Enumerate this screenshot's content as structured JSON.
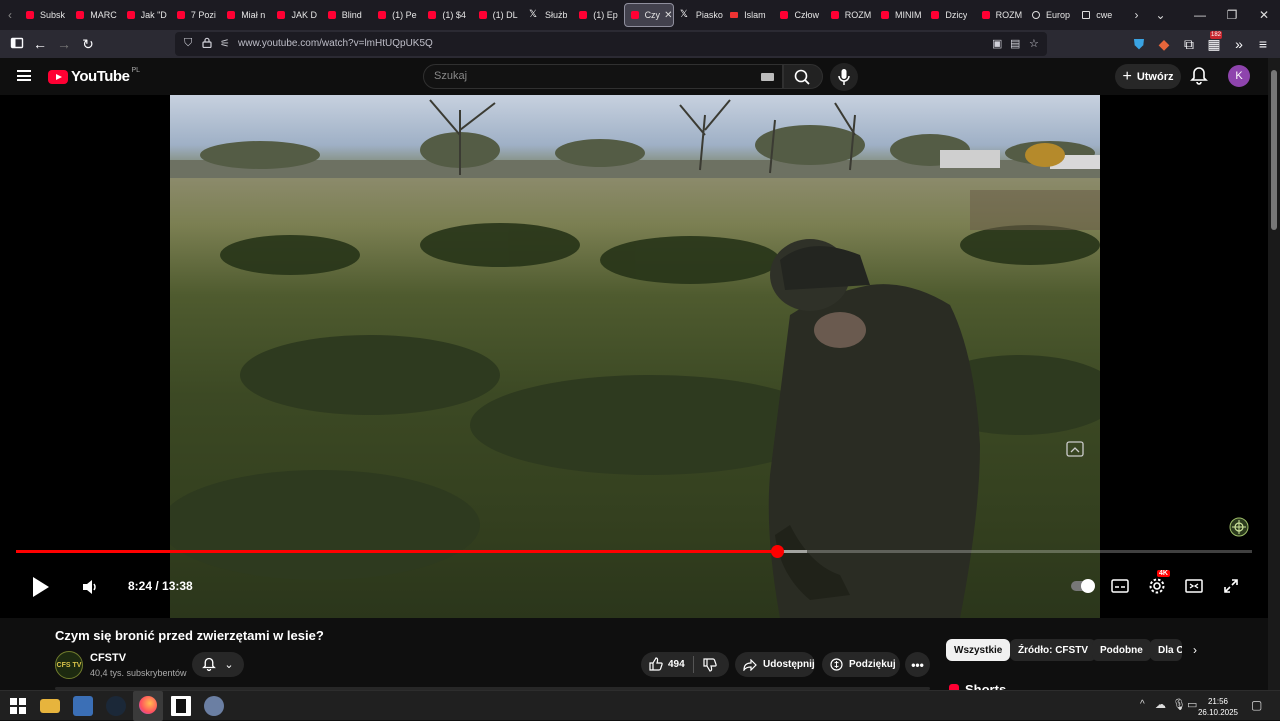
{
  "browser": {
    "tabs": [
      {
        "label": "Subsk",
        "icon": "youtube-icon"
      },
      {
        "label": "MARC",
        "icon": "youtube-icon"
      },
      {
        "label": "Jak \"D",
        "icon": "youtube-icon"
      },
      {
        "label": "7 Pozi",
        "icon": "youtube-icon"
      },
      {
        "label": "Miał n",
        "icon": "youtube-icon"
      },
      {
        "label": "JAK D",
        "icon": "youtube-icon"
      },
      {
        "label": "Blind",
        "icon": "youtube-icon"
      },
      {
        "label": "(1) Pe",
        "icon": "youtube-icon"
      },
      {
        "label": "(1) $4",
        "icon": "youtube-icon"
      },
      {
        "label": "(1) DL",
        "icon": "youtube-icon"
      },
      {
        "label": "Służb",
        "icon": "x-icon"
      },
      {
        "label": "(1) Ep",
        "icon": "youtube-icon"
      },
      {
        "label": "Czy",
        "icon": "youtube-icon",
        "active": true
      },
      {
        "label": "Piasko",
        "icon": "x-icon"
      },
      {
        "label": "Islam",
        "icon": "onet-icon"
      },
      {
        "label": "Człow",
        "icon": "youtube-icon"
      },
      {
        "label": "ROZM",
        "icon": "youtube-icon"
      },
      {
        "label": "MINIM",
        "icon": "youtube-icon"
      },
      {
        "label": "Dzicy",
        "icon": "youtube-icon"
      },
      {
        "label": "ROZM",
        "icon": "youtube-icon"
      },
      {
        "label": "Europ",
        "icon": "globe-icon"
      },
      {
        "label": "cwe",
        "icon": "grid-icon"
      }
    ],
    "url": "www.youtube.com/watch?v=lmHtUQpUK5Q",
    "extension_badge": "182"
  },
  "youtube": {
    "logo_text": "YouTube",
    "country_code": "PL",
    "search_placeholder": "Szukaj",
    "create_label": "Utwórz",
    "avatar_letter": "K"
  },
  "player": {
    "current_time": "8:24",
    "duration": "13:38",
    "time_display": "8:24 / 13:38",
    "progress_fraction": 0.616,
    "buffered_fraction": 0.64,
    "quality_badge": "4K",
    "colors": {
      "progress": "#ff0000",
      "brand": "#ff0033"
    }
  },
  "video": {
    "title": "Czym się bronić przed zwierzętami w lesie?",
    "channel_name": "CFSTV",
    "channel_avatar_text": "CFS TV",
    "subscribers": "40,4 tys. subskrybentów",
    "likes": "494",
    "share_label": "Udostępnij",
    "thanks_label": "Podziękuj"
  },
  "related": {
    "chips": [
      {
        "label": "Wszystkie",
        "selected": true
      },
      {
        "label": "Źródło: CFSTV",
        "selected": false
      },
      {
        "label": "Podobne",
        "selected": false
      },
      {
        "label": "Dla C",
        "selected": false
      }
    ],
    "shorts_label": "Shorts"
  },
  "taskbar": {
    "time": "21:56",
    "date": "26.10.2025"
  }
}
